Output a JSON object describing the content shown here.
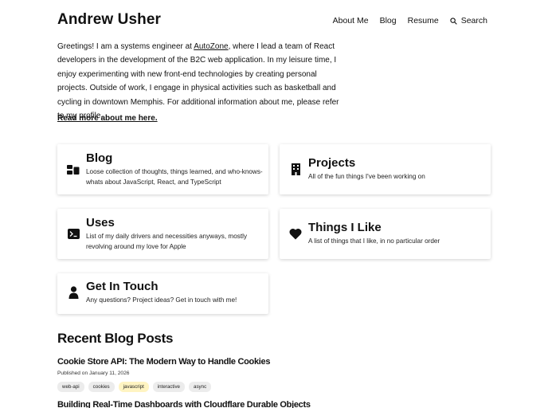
{
  "header": {
    "title": "Andrew Usher",
    "nav": [
      "About Me",
      "Blog",
      "Resume"
    ],
    "search_label": "Search"
  },
  "intro": {
    "before_link": "Greetings! I am a systems engineer at ",
    "link_text": "AutoZone",
    "after_link": ", where I lead a team of React developers in the development of the B2C web application. In my leisure time, I enjoy experimenting with new front-end technologies by creating personal projects. Outside of work, I engage in physical activities such as basketball and cycling in downtown Memphis. For additional information about me, please refer to my profile.",
    "read_more": "Read more about me here."
  },
  "cards": [
    {
      "title": "Blog",
      "description": "Loose collection of thoughts, things learned, and who-knows-whats about JavaScript, React, and TypeScript",
      "icon": "blog-icon"
    },
    {
      "title": "Projects",
      "description": "All of the fun things I've been working on",
      "icon": "building-icon"
    },
    {
      "title": "Uses",
      "description": "List of my daily drivers and necessities anyways, mostly revolving around my love for Apple",
      "icon": "terminal-icon"
    },
    {
      "title": "Things I Like",
      "description": "A list of things that I like, in no particular order",
      "icon": "heart-icon"
    },
    {
      "title": "Get In Touch",
      "description": "Any questions? Project ideas? Get in touch with me!",
      "icon": "person-icon"
    }
  ],
  "recent": {
    "heading": "Recent Blog Posts",
    "posts": [
      {
        "title": "Cookie Store API: The Modern Way to Handle Cookies",
        "date": "Published on January 11, 2026",
        "tags": [
          "web-api",
          "cookies",
          "javascript",
          "interactive",
          "async"
        ]
      },
      {
        "title": "Building Real-Time Dashboards with Cloudflare Durable Objects"
      }
    ]
  },
  "colors": {
    "text": "#111111",
    "tag_bg": "#ececec",
    "tag_highlight": "#fff4c2"
  }
}
